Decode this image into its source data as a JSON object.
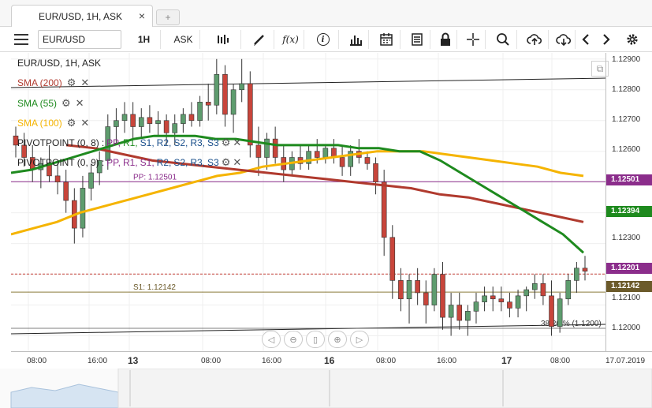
{
  "tab": {
    "title": "EUR/USD, 1H, ASK",
    "close": "×",
    "new_tab": "+"
  },
  "toolbar": {
    "symbol": "EUR/USD",
    "timeframe": "1H",
    "price_side": "ASK",
    "fx_label": "f(x)",
    "info_label": "i"
  },
  "chart": {
    "title": "EUR/USD, 1H, ASK",
    "indicators": [
      {
        "label": "SMA (200)",
        "color": "#b03a2e"
      },
      {
        "label": "SMA (55)",
        "color": "#1e8a1e"
      },
      {
        "label": "SMA (100)",
        "color": "#f5b400"
      }
    ],
    "pivot1": {
      "prefix": "PIVOTPOINT (0, 8)",
      "sep": ":",
      "PP": "PP,",
      "R1": "R1,",
      "S1": "S1,",
      "R2": "R2,",
      "S2": "S2,",
      "R3": "R3,",
      "S3": "S3"
    },
    "pivot2": {
      "prefix": "PIVOTPOINT (0, 9)",
      "sep": ":",
      "PP": "PP,",
      "R1": "R1,",
      "S1": "S1,",
      "R2": "R2,",
      "S2": "S2,",
      "R3": "R3,",
      "S3": "S3"
    },
    "pp_label": "PP: 1.12501",
    "s1_label": "S1: 1.12142",
    "fib_label": "38.20 % (1.1200)"
  },
  "price_axis": {
    "ticks": [
      "1.12900",
      "1.12800",
      "1.12700",
      "1.12600",
      "1.12300",
      "1.12100",
      "1.12000"
    ],
    "tags": [
      {
        "value": "1.12501",
        "color": "#8b2d8b"
      },
      {
        "value": "1.12394",
        "color": "#1e8a1e"
      },
      {
        "value": "1.12201",
        "color": "#8b2d8b"
      },
      {
        "value": "1.12142",
        "color": "#6b5a2a"
      }
    ]
  },
  "time_axis": {
    "labels": [
      "08:00",
      "16:00",
      "13",
      "08:00",
      "16:00",
      "16",
      "08:00",
      "16:00",
      "17",
      "08:00",
      "17.07.2019"
    ]
  },
  "colors": {
    "bull": "#5e9c6e",
    "bear": "#c8453b",
    "sma200": "#b03a2e",
    "sma55": "#1e8a1e",
    "sma100": "#f5b400",
    "pivot": "#8b2d8b"
  },
  "chart_data": {
    "type": "candlestick",
    "ylim": [
      1.1195,
      1.1292
    ],
    "candles": [
      [
        1.1265,
        1.1268,
        1.1258,
        1.1262
      ],
      [
        1.1262,
        1.1266,
        1.1255,
        1.1258
      ],
      [
        1.1258,
        1.1262,
        1.125,
        1.1254
      ],
      [
        1.1254,
        1.1258,
        1.1248,
        1.1256
      ],
      [
        1.1256,
        1.1262,
        1.125,
        1.1252
      ],
      [
        1.1252,
        1.1256,
        1.1246,
        1.125
      ],
      [
        1.125,
        1.1254,
        1.124,
        1.1244
      ],
      [
        1.1244,
        1.1248,
        1.123,
        1.1235
      ],
      [
        1.1235,
        1.1252,
        1.1232,
        1.1248
      ],
      [
        1.1248,
        1.1256,
        1.1244,
        1.1253
      ],
      [
        1.1253,
        1.126,
        1.1249,
        1.1257
      ],
      [
        1.1257,
        1.1272,
        1.1254,
        1.1268
      ],
      [
        1.1268,
        1.1274,
        1.1262,
        1.127
      ],
      [
        1.127,
        1.1276,
        1.1266,
        1.1272
      ],
      [
        1.1272,
        1.1276,
        1.1264,
        1.1268
      ],
      [
        1.1268,
        1.1274,
        1.1264,
        1.1271
      ],
      [
        1.1271,
        1.1275,
        1.1266,
        1.1269
      ],
      [
        1.1269,
        1.1273,
        1.1265,
        1.127
      ],
      [
        1.127,
        1.1272,
        1.1262,
        1.1266
      ],
      [
        1.1266,
        1.1272,
        1.1262,
        1.1269
      ],
      [
        1.1269,
        1.1274,
        1.1266,
        1.1272
      ],
      [
        1.1272,
        1.1276,
        1.1268,
        1.127
      ],
      [
        1.127,
        1.1278,
        1.1268,
        1.1276
      ],
      [
        1.1276,
        1.1282,
        1.127,
        1.1275
      ],
      [
        1.1275,
        1.129,
        1.1272,
        1.1285
      ],
      [
        1.1285,
        1.1288,
        1.1268,
        1.1272
      ],
      [
        1.1272,
        1.1282,
        1.1266,
        1.128
      ],
      [
        1.128,
        1.129,
        1.1276,
        1.1282
      ],
      [
        1.1282,
        1.1286,
        1.1258,
        1.1262
      ],
      [
        1.1262,
        1.1268,
        1.1252,
        1.1258
      ],
      [
        1.1258,
        1.1266,
        1.1254,
        1.1264
      ],
      [
        1.1264,
        1.1268,
        1.1256,
        1.1258
      ],
      [
        1.1258,
        1.1262,
        1.125,
        1.1254
      ],
      [
        1.1254,
        1.126,
        1.1252,
        1.1258
      ],
      [
        1.1258,
        1.1262,
        1.1254,
        1.1256
      ],
      [
        1.1256,
        1.1262,
        1.1254,
        1.126
      ],
      [
        1.126,
        1.1264,
        1.1256,
        1.1258
      ],
      [
        1.1258,
        1.1262,
        1.1256,
        1.1261
      ],
      [
        1.1261,
        1.1264,
        1.1256,
        1.1258
      ],
      [
        1.1258,
        1.1262,
        1.1252,
        1.1255
      ],
      [
        1.1255,
        1.1262,
        1.1252,
        1.126
      ],
      [
        1.126,
        1.1264,
        1.1256,
        1.1258
      ],
      [
        1.1258,
        1.126,
        1.1254,
        1.1256
      ],
      [
        1.1256,
        1.1258,
        1.1246,
        1.125
      ],
      [
        1.125,
        1.1254,
        1.1226,
        1.1232
      ],
      [
        1.1232,
        1.1236,
        1.1212,
        1.1218
      ],
      [
        1.1218,
        1.1222,
        1.1208,
        1.1212
      ],
      [
        1.1212,
        1.122,
        1.1204,
        1.1218
      ],
      [
        1.1218,
        1.1222,
        1.121,
        1.1214
      ],
      [
        1.1214,
        1.1218,
        1.1204,
        1.121
      ],
      [
        1.121,
        1.1222,
        1.1208,
        1.122
      ],
      [
        1.122,
        1.1224,
        1.1202,
        1.1206
      ],
      [
        1.1206,
        1.1214,
        1.12,
        1.121
      ],
      [
        1.121,
        1.1214,
        1.1202,
        1.1205
      ],
      [
        1.1205,
        1.121,
        1.12,
        1.1208
      ],
      [
        1.1208,
        1.1214,
        1.1204,
        1.1211
      ],
      [
        1.1211,
        1.1216,
        1.1208,
        1.1213
      ],
      [
        1.1213,
        1.1216,
        1.1208,
        1.1212
      ],
      [
        1.1212,
        1.1216,
        1.1208,
        1.1211
      ],
      [
        1.1211,
        1.1214,
        1.1206,
        1.1209
      ],
      [
        1.1209,
        1.1215,
        1.1206,
        1.1213
      ],
      [
        1.1213,
        1.1216,
        1.1208,
        1.1215
      ],
      [
        1.1215,
        1.122,
        1.1212,
        1.1217
      ],
      [
        1.1217,
        1.122,
        1.121,
        1.1213
      ],
      [
        1.1213,
        1.1218,
        1.12,
        1.1203
      ],
      [
        1.1203,
        1.1214,
        1.1201,
        1.1212
      ],
      [
        1.1212,
        1.122,
        1.121,
        1.1218
      ],
      [
        1.1218,
        1.1224,
        1.1214,
        1.1222
      ],
      [
        1.1222,
        1.1226,
        1.1218,
        1.1221
      ]
    ],
    "sma55": [
      1.1253,
      1.1254,
      1.1256,
      1.1258,
      1.126,
      1.1262,
      1.1264,
      1.1265,
      1.1265,
      1.1265,
      1.1264,
      1.1264,
      1.1263,
      1.1262,
      1.1262,
      1.1262,
      1.1262,
      1.1261,
      1.1261,
      1.126,
      1.126,
      1.1257,
      1.1253,
      1.1249,
      1.1245,
      1.1241,
      1.1237,
      1.1233,
      1.1227
    ],
    "sma100": [
      1.1233,
      1.1235,
      1.1237,
      1.124,
      1.1242,
      1.1244,
      1.1246,
      1.1248,
      1.125,
      1.1252,
      1.1253,
      1.1255,
      1.1256,
      1.1257,
      1.1258,
      1.1259,
      1.126,
      1.126,
      1.126,
      1.1259,
      1.1258,
      1.1257,
      1.1256,
      1.1255,
      1.1253,
      1.1252
    ],
    "sma200": [
      1.1262,
      1.1261,
      1.1259,
      1.1257,
      1.1256,
      1.1255,
      1.1254,
      1.1253,
      1.1252,
      1.1251,
      1.125,
      1.1249,
      1.1248,
      1.1246,
      1.1245,
      1.1243,
      1.1241,
      1.1239,
      1.1237
    ],
    "pivot_pp": 1.12501,
    "pivot_s1": 1.12142,
    "last_price": 1.12201
  }
}
